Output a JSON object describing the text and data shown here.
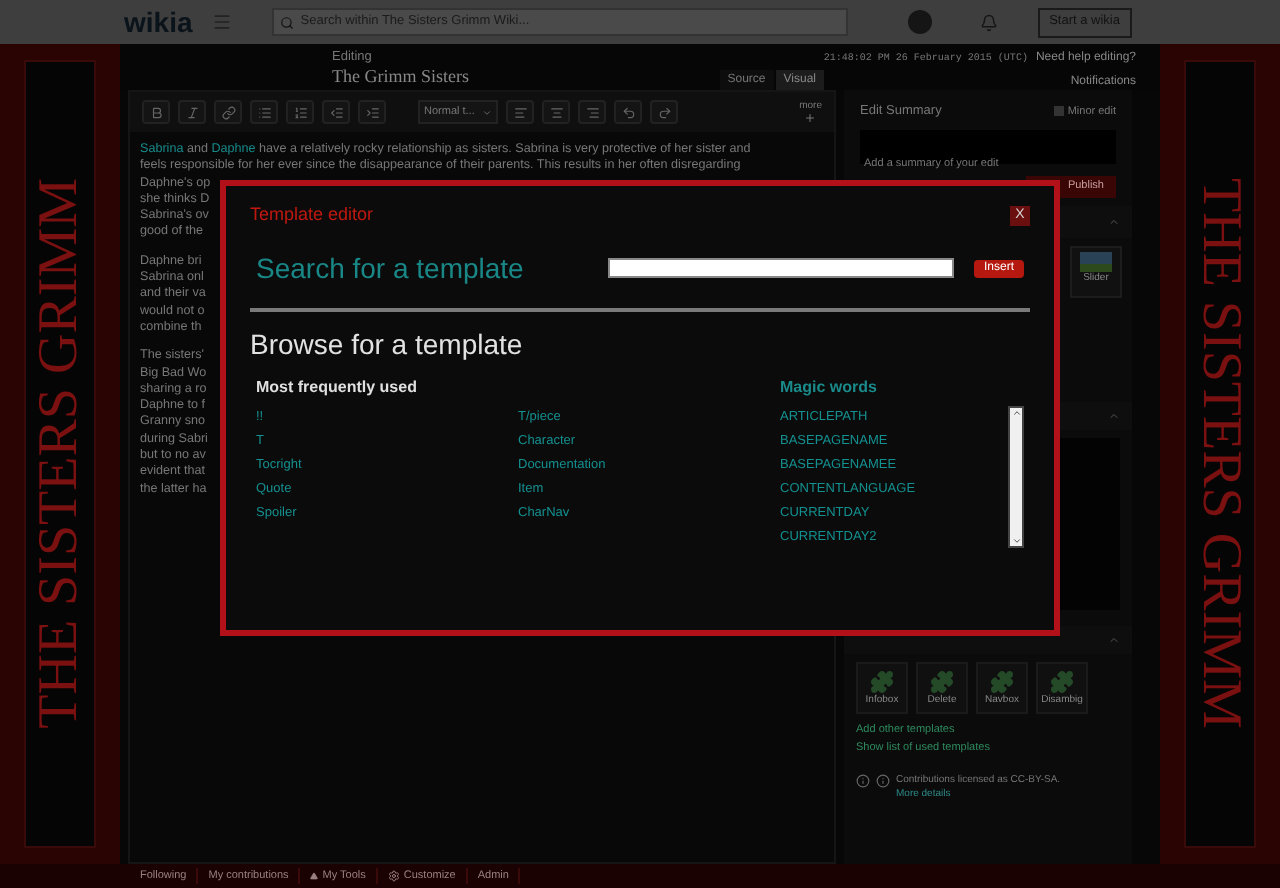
{
  "top_bar": {
    "logo": "wikia",
    "search_placeholder": "Search within The Sisters Grimm Wiki...",
    "start_button": "Start a wikia"
  },
  "banners": {
    "left": "THE SISTERS GRIMM",
    "right": "THE SISTERS GRIMM"
  },
  "editor_header": {
    "label": "Editing",
    "title": "The Grimm Sisters",
    "timestamp": "21:48:02 PM 26 February 2015 (UTC)",
    "help_link": "Need help editing?",
    "notifications": "Notifications"
  },
  "mode_tabs": [
    {
      "label": "Source",
      "selected": false
    },
    {
      "label": "Visual",
      "selected": true
    }
  ],
  "toolbar": {
    "format_dropdown": "Normal t...",
    "more": "more"
  },
  "article": {
    "paragraphs": [
      [
        [
          {
            "text": "Sabrina",
            "link": true
          },
          {
            "text": " and ",
            "link": false
          },
          {
            "text": "Daphne",
            "link": true
          },
          {
            "text": " have a relatively rocky relationship as sisters. Sabrina is very protective of her sister and",
            "link": false
          }
        ],
        [
          {
            "text": "feels responsible for her ever since the disappearance of their parents. This results in her often disregarding",
            "link": false
          }
        ],
        [
          {
            "text": "Daphne's op",
            "link": false
          }
        ],
        [
          {
            "text": "she thinks D",
            "link": false
          }
        ],
        [
          {
            "text": "Sabrina's ov",
            "link": false
          }
        ],
        [
          {
            "text": "good of the",
            "link": false
          }
        ]
      ],
      [
        [
          {
            "text": "Daphne bri",
            "link": false
          }
        ],
        [
          {
            "text": "Sabrina onl",
            "link": false
          }
        ],
        [
          {
            "text": "and their va",
            "link": false
          }
        ],
        [
          {
            "text": "would not o",
            "link": false
          }
        ],
        [
          {
            "text": "combine th",
            "link": false
          }
        ]
      ],
      [
        [
          {
            "text": "The sisters'",
            "link": false
          }
        ],
        [
          {
            "text": "Big Bad Wo",
            "link": false
          }
        ],
        [
          {
            "text": "sharing a ro",
            "link": false
          }
        ],
        [
          {
            "text": "Daphne to f",
            "link": false
          }
        ],
        [
          {
            "text": "Granny sno",
            "link": false
          }
        ],
        [
          {
            "text": "during Sabri",
            "link": false
          }
        ],
        [
          {
            "text": "but to no av",
            "link": false
          }
        ],
        [
          {
            "text": "evident that",
            "link": false
          }
        ],
        [
          {
            "text": "the latter ha",
            "link": false
          }
        ]
      ]
    ]
  },
  "edit_summary": {
    "title": "Edit Summary",
    "minor_edit": {
      "label": "Minor edit",
      "checked": false
    },
    "placeholder": "Add a summary of your edit",
    "publish": "Publish"
  },
  "slider_label": "Slider",
  "templates": [
    "Infobox",
    "Delete",
    "Navbox",
    "Disambig"
  ],
  "template_links": [
    "Add other templates",
    "Show list of used templates"
  ],
  "license": {
    "text": "Contributions licensed as CC-BY-SA.",
    "link": "More details"
  },
  "footer": [
    {
      "label": "Following",
      "kind": "plain"
    },
    {
      "label": "My contributions",
      "kind": "plain"
    },
    {
      "label": "My Tools",
      "kind": "caret"
    },
    {
      "label": "Customize",
      "kind": "gear"
    },
    {
      "label": "Admin",
      "kind": "plain"
    }
  ],
  "modal": {
    "title": "Template editor",
    "close": "X",
    "search_heading": "Search for a template",
    "insert": "Insert",
    "browse_heading": "Browse for a template",
    "frequent_heading": "Most frequently used",
    "frequent": [
      "!!",
      "T",
      "Tocright",
      "Quote",
      "Spoiler",
      "T/piece",
      "Character",
      "Documentation",
      "Item",
      "CharNav"
    ],
    "magic_heading": "Magic words",
    "magic_words": [
      "ARTICLEPATH",
      "BASEPAGENAME",
      "BASEPAGENAMEE",
      "CONTENTLANGUAGE",
      "CURRENTDAY",
      "CURRENTDAY2"
    ]
  }
}
